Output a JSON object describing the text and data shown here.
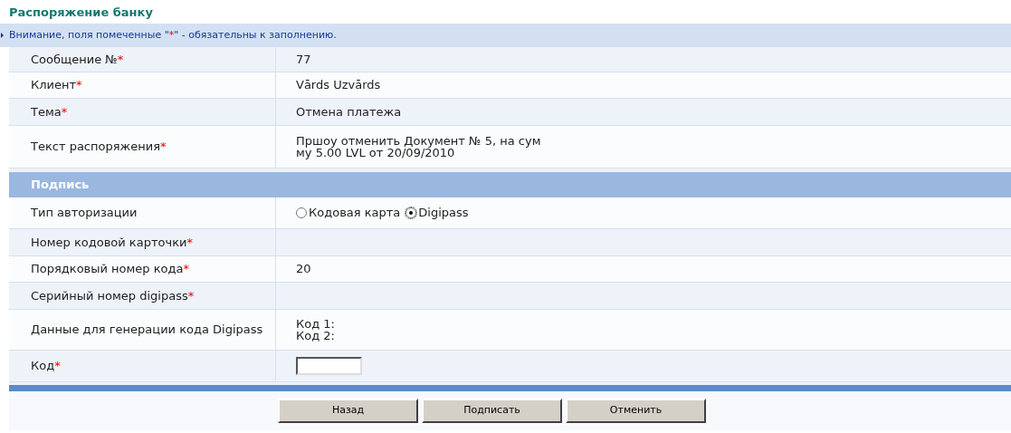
{
  "title": "Распоряжение банку",
  "notice": {
    "before": "Внимание, поля помеченные \"",
    "mark": "*",
    "after": "\" - обязательны к заполнению."
  },
  "rows": [
    {
      "kind": "text",
      "label": "Сообщение №",
      "mark": "*",
      "value": "77"
    },
    {
      "kind": "text",
      "label": "Клиент",
      "mark": "*",
      "value": "Vārds Uzvārds"
    },
    {
      "kind": "text",
      "label": "Тема",
      "mark": "*",
      "value": "Отмена платежа"
    },
    {
      "kind": "lines",
      "label": "Текст распоряжения",
      "mark": "*",
      "lines": [
        "Пршоу отменить Документ № 5, на сум",
        "му 5.00 LVL от 20/09/2010"
      ]
    }
  ],
  "signature": {
    "heading": "Подпись",
    "rows": [
      {
        "kind": "radio",
        "label": "Тип авторизации",
        "options": [
          {
            "label": "Кодовая карта",
            "selected": false
          },
          {
            "label": "Digipass",
            "selected": true
          }
        ]
      },
      {
        "kind": "empty",
        "label": "Номер кодовой карточки",
        "mark": "*"
      },
      {
        "kind": "text",
        "label": "Порядковый номер кода",
        "mark": "*",
        "value": "20"
      },
      {
        "kind": "empty",
        "label": "Серийный номер digipass",
        "mark": "*"
      },
      {
        "kind": "lines",
        "label": "Данные для генерации кода Digipass",
        "lines": [
          "Код 1:",
          "Код 2:"
        ]
      },
      {
        "kind": "input",
        "label": "Код",
        "mark": "*"
      }
    ]
  },
  "buttons": [
    "Назад",
    "Подписать",
    "Отменить"
  ]
}
